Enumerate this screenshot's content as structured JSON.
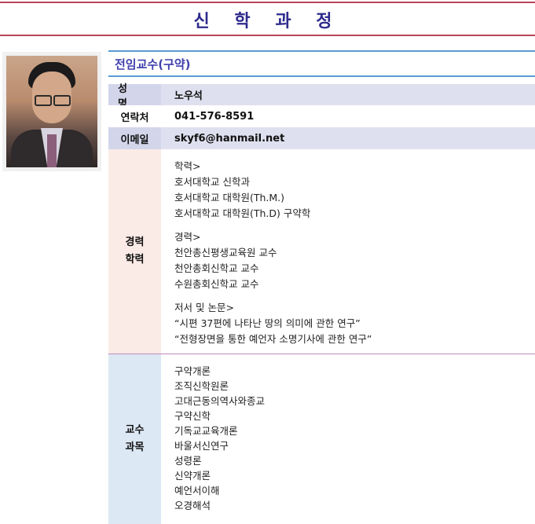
{
  "page": {
    "title": "신 학 과 정"
  },
  "section": {
    "label": "전임교수(구약)"
  },
  "profile": {
    "name_label": "성 명",
    "name_value": "노우석",
    "phone_label": "연락처",
    "phone_value": "041-576-8591",
    "email_label": "이메일",
    "email_value": "skyf6@hanmail.net"
  },
  "career": {
    "side_line1": "경력",
    "side_line2": "학력",
    "education_heading": "학력>",
    "education": [
      "호서대학교 신학과",
      "호서대학교 대학원(Th.M.)",
      "호서대학교 대학원(Th.D) 구약학"
    ],
    "career_heading": "경력>",
    "careers": [
      "천안총신평생교육원 교수",
      "천안총회신학교 교수",
      "수원총회신학교 교수"
    ],
    "papers_heading": "저서 및 논문>",
    "papers": [
      "“시편 37편에 나타난 땅의 의미에 관한 연구”",
      "“전형장면을 통한 예언자 소명기사에 관한 연구”"
    ]
  },
  "courses": {
    "side_line1": "교수",
    "side_line2": "과목",
    "items": [
      "구약개론",
      "조직신학원론",
      "고대근동의역사와종교",
      "구약신학",
      "기독교교육개론",
      "바울서신연구",
      "성령론",
      "신약개론",
      "예언서이해",
      "오경해석"
    ]
  },
  "colors": {
    "title": "#2d2a8c",
    "title_rules": "#b8455b",
    "section_label": "#3f3fae",
    "section_rules": "#5b9bd5",
    "row_band": "#dfe0ef",
    "career_side": "#fbebe6",
    "courses_side": "#dde8f5"
  }
}
